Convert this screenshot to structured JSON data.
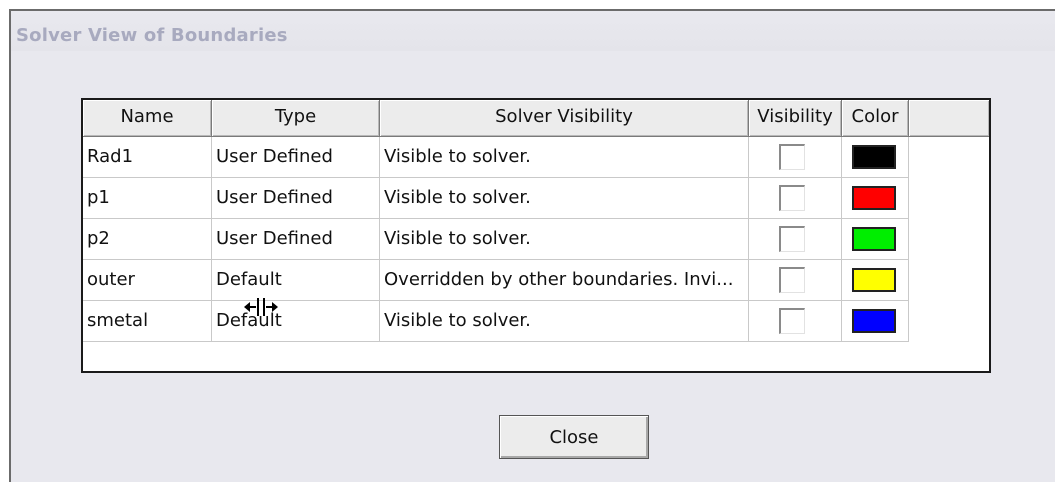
{
  "window": {
    "title": "Solver View of Boundaries"
  },
  "table": {
    "headers": [
      "Name",
      "Type",
      "Solver Visibility",
      "Visibility",
      "Color"
    ],
    "rows": [
      {
        "name": "Rad1",
        "type": "User Defined",
        "solver_visibility": "Visible to solver.",
        "visible": false,
        "color": "#000000",
        "color_name": "black"
      },
      {
        "name": "p1",
        "type": "User Defined",
        "solver_visibility": "Visible to solver.",
        "visible": false,
        "color": "#ff0000",
        "color_name": "red"
      },
      {
        "name": "p2",
        "type": "User Defined",
        "solver_visibility": "Visible to solver.",
        "visible": false,
        "color": "#00ee00",
        "color_name": "green"
      },
      {
        "name": "outer",
        "type": "Default",
        "solver_visibility": "Overridden by other boundaries. Invi...",
        "visible": false,
        "color": "#ffff00",
        "color_name": "yellow"
      },
      {
        "name": "smetal",
        "type": "Default",
        "solver_visibility": "Visible to solver.",
        "visible": false,
        "color": "#0000ff",
        "color_name": "blue"
      }
    ]
  },
  "buttons": {
    "close_label": "Close"
  },
  "cursor": {
    "icon": "column-resize-cursor-icon"
  }
}
